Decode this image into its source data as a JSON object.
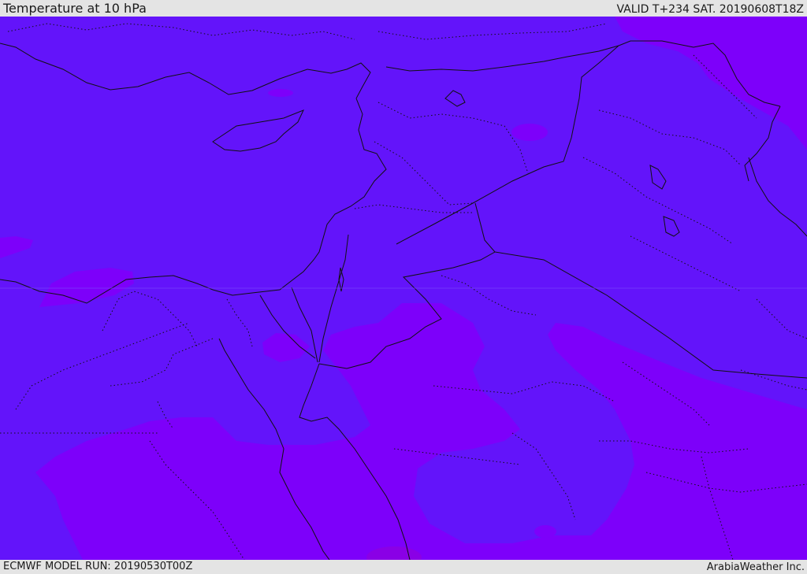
{
  "header": {
    "title": "Temperature at 10 hPa",
    "valid_time": "VALID T+234 SAT. 20190608T18Z"
  },
  "footer": {
    "model_run": "ECMWF MODEL RUN: 20190530T00Z",
    "credit": "ArabiaWeather Inc."
  },
  "map": {
    "field": "Temperature at 10 hPa",
    "colors": {
      "background_band": "#6314fa",
      "warmer_band": "#7d00fa",
      "warmest_patch": "#8a00e6",
      "boundaries": "#111111",
      "frame": "#e4e4e4"
    }
  }
}
